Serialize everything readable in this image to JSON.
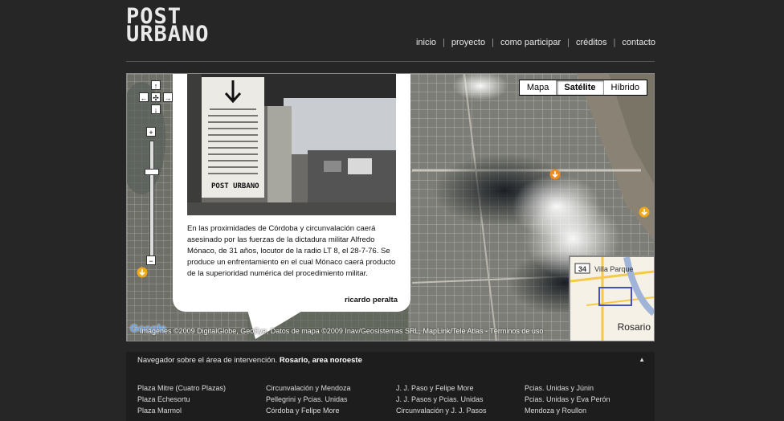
{
  "brand": {
    "line1": "POST",
    "line2": "URBANO"
  },
  "nav": {
    "items": [
      "inicio",
      "proyecto",
      "como participar",
      "créditos",
      "contacto"
    ],
    "separator": "|"
  },
  "map": {
    "types": [
      "Mapa",
      "Satélite",
      "Híbrido"
    ],
    "active_type": "Satélite",
    "attribution": "Imágenes ©2009 DigitalGlobe, GeoEye, Datos de mapa ©2009 Inav/Geosistemas SRL, MapLink/Tele Atlas - Términos de uso",
    "google_logo": "Google",
    "controls": {
      "up": "↑",
      "left": "←",
      "center": "✣",
      "right": "→",
      "down": "↓",
      "zoom_in": "+",
      "zoom_out": "−"
    },
    "overview": {
      "route": "34",
      "place1": "Villa Parque",
      "place2": "Rosario"
    }
  },
  "popup": {
    "text": "En las proximidades de Córdoba y circunvalación caerá asesinado por las fuerzas de la dictadura militar Alfredo Mónaco, de 31 años, locutor de la radio LT 8, el 28-7-76. Se produce un enfrentamiento en el cual Mónaco caerá producto de la superioridad numérica del procedimiento militar.",
    "author": "ricardo peralta",
    "photo_sign_logo": "POST URBANO"
  },
  "panel": {
    "title_prefix": "Navegador sobre el área de intervención.",
    "title_bold": "Rosario, area noroeste",
    "collapse_icon": "▲",
    "columns": [
      [
        "Plaza Mitre (Cuatro Plazas)",
        "Plaza Echesortu",
        "Plaza Marmol"
      ],
      [
        "Circunvalación y Mendoza",
        "Pellegrini y Pcias. Unidas",
        "Córdoba y Felipe More"
      ],
      [
        "J. J. Paso y Felipe More",
        "J. J. Pasos y Pcias. Unidas",
        "Circunvalación y J. J. Pasos"
      ],
      [
        "Pcias. Unidas y Júnin",
        "Pcias. Unidas y Eva Perón",
        "Mendoza y Roullon"
      ]
    ]
  },
  "colors": {
    "background": "#262626",
    "panel": "#1d1d1d",
    "marker": "#f08a1c"
  }
}
